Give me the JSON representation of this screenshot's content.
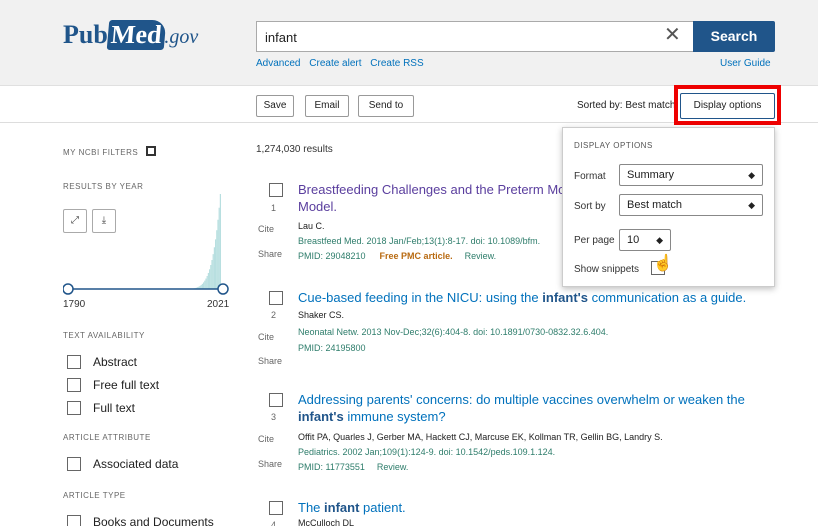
{
  "header": {
    "logo_text": "Pub",
    "logo_m": "Med",
    "logo_gov": ".gov",
    "search_value": "infant",
    "search_label": "Search",
    "links": [
      "Advanced",
      "Create alert",
      "Create RSS"
    ],
    "user_guide": "User Guide"
  },
  "actions": {
    "save": "Save",
    "email": "Email",
    "send_to": "Send to",
    "sorted_by": "Sorted by: Best match",
    "display_options": "Display options"
  },
  "sidebar": {
    "ncbi_filters": "MY NCBI FILTERS",
    "results_by_year": "RESULTS BY YEAR",
    "year_start": "1790",
    "year_end": "2021",
    "text_availability": "TEXT AVAILABILITY",
    "text_filters": [
      "Abstract",
      "Free full text",
      "Full text"
    ],
    "article_attribute": "ARTICLE ATTRIBUTE",
    "attribute_filters": [
      "Associated data"
    ],
    "article_type": "ARTICLE TYPE",
    "type_filters": [
      "Books and Documents"
    ]
  },
  "results": {
    "count": "1,274,030 results",
    "items": [
      {
        "num": "1",
        "title_a": "Breastfeeding Challenges and the Preterm Mo",
        "title_b": "Model.",
        "authors": "Lau C.",
        "citation": "Breastfeed Med. 2018 Jan/Feb;13(1):8-17. doi: 10.1089/bfm.",
        "pmid": "PMID: 29048210",
        "free": "Free PMC article.",
        "review": "Review."
      },
      {
        "num": "2",
        "title_a": "Cue-based feeding in the NICU: using the ",
        "title_bold": "infant's",
        "title_c": " communication as a guide.",
        "authors": "Shaker CS.",
        "citation": "Neonatal Netw. 2013 Nov-Dec;32(6):404-8. doi: 10.1891/0730-0832.32.6.404.",
        "pmid": "PMID: 24195800"
      },
      {
        "num": "3",
        "title_a": "Addressing parents' concerns: do multiple vaccines overwhelm or weaken the",
        "title_bold": "infant's",
        "title_c": " immune system?",
        "authors": "Offit PA, Quarles J, Gerber MA, Hackett CJ, Marcuse EK, Kollman TR, Gellin BG, Landry S.",
        "citation": "Pediatrics. 2002 Jan;109(1):124-9. doi: 10.1542/peds.109.1.124.",
        "pmid": "PMID: 11773551",
        "review": "Review."
      },
      {
        "num": "4",
        "title_a": "The ",
        "title_bold": "infant",
        "title_c": " patient.",
        "authors": "McCulloch DL"
      }
    ],
    "cite": "Cite",
    "share": "Share"
  },
  "display_panel": {
    "heading": "DISPLAY OPTIONS",
    "format_label": "Format",
    "format_value": "Summary",
    "sortby_label": "Sort by",
    "sortby_value": "Best match",
    "perpage_label": "Per page",
    "perpage_value": "10",
    "snippets_label": "Show snippets"
  }
}
